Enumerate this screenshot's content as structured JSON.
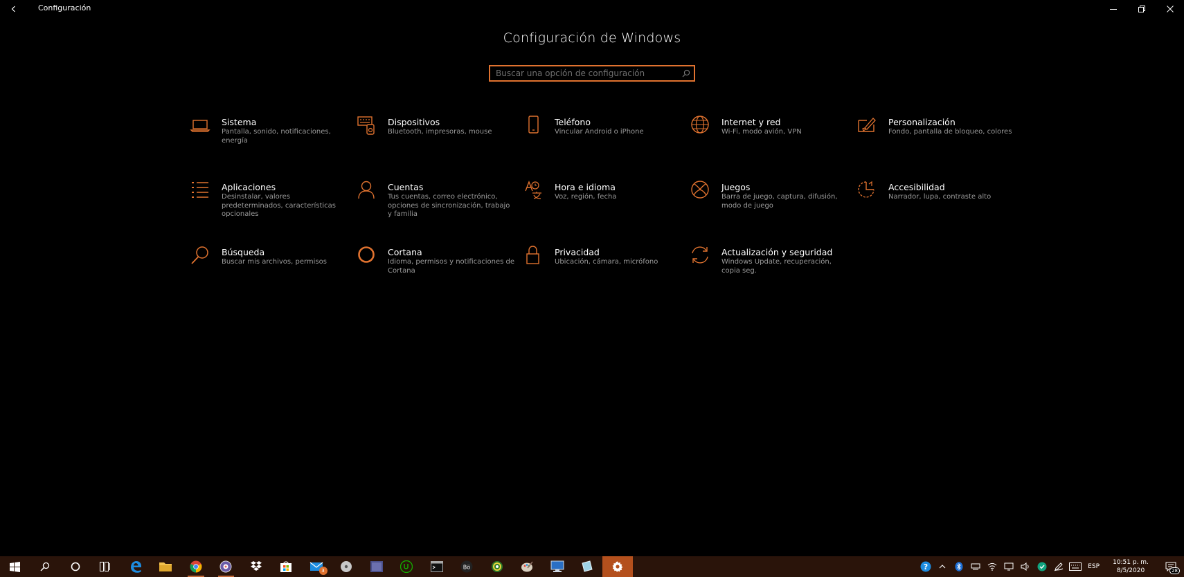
{
  "window": {
    "title": "Configuración"
  },
  "heading": "Configuración de Windows",
  "search": {
    "placeholder": "Buscar una opción de configuración",
    "value": ""
  },
  "accent_color": "#e0722f",
  "categories": [
    {
      "title": "Sistema",
      "desc": "Pantalla, sonido, notificaciones, energía",
      "icon": "laptop-icon"
    },
    {
      "title": "Dispositivos",
      "desc": "Bluetooth, impresoras, mouse",
      "icon": "keyboard-icon"
    },
    {
      "title": "Teléfono",
      "desc": "Vincular Android o iPhone",
      "icon": "phone-icon"
    },
    {
      "title": "Internet y red",
      "desc": "Wi-Fi, modo avión, VPN",
      "icon": "globe-icon"
    },
    {
      "title": "Personalización",
      "desc": "Fondo, pantalla de bloqueo, colores",
      "icon": "paint-icon"
    },
    {
      "title": "Aplicaciones",
      "desc": "Desinstalar, valores predeterminados, características opcionales",
      "icon": "apps-list-icon"
    },
    {
      "title": "Cuentas",
      "desc": "Tus cuentas, correo electrónico, opciones de sincronización, trabajo y familia",
      "icon": "person-icon"
    },
    {
      "title": "Hora e idioma",
      "desc": "Voz, región, fecha",
      "icon": "time-language-icon"
    },
    {
      "title": "Juegos",
      "desc": "Barra de juego, captura, difusión, modo de juego",
      "icon": "xbox-icon"
    },
    {
      "title": "Accesibilidad",
      "desc": "Narrador, lupa, contraste alto",
      "icon": "accessibility-icon"
    },
    {
      "title": "Búsqueda",
      "desc": "Buscar mis archivos, permisos",
      "icon": "search-icon"
    },
    {
      "title": "Cortana",
      "desc": "Idioma, permisos y notificaciones de Cortana",
      "icon": "cortana-icon"
    },
    {
      "title": "Privacidad",
      "desc": "Ubicación, cámara, micrófono",
      "icon": "lock-icon"
    },
    {
      "title": "Actualización y seguridad",
      "desc": "Windows Update, recuperación, copia seg.",
      "icon": "update-icon"
    }
  ],
  "taskbar": {
    "mail_badge": "3",
    "language": "ESP",
    "time": "10:51 p. m.",
    "date": "8/5/2020",
    "notification_count": "28"
  }
}
